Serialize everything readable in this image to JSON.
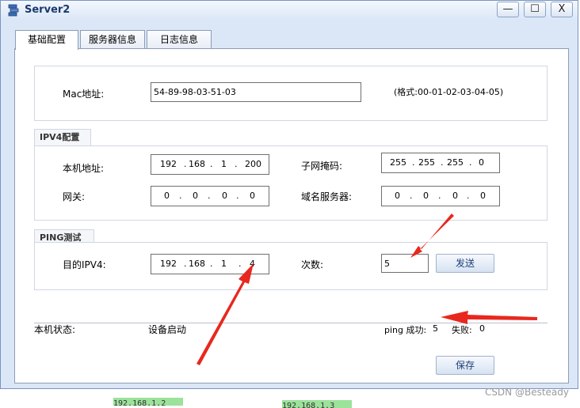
{
  "window": {
    "title": "Server2",
    "controls": {
      "minimize": "—",
      "maximize": "☐",
      "close": "X"
    }
  },
  "tabs": [
    {
      "label": "基础配置",
      "active": true
    },
    {
      "label": "服务器信息",
      "active": false
    },
    {
      "label": "日志信息",
      "active": false
    }
  ],
  "mac": {
    "label": "Mac地址:",
    "value": "54-89-98-03-51-03",
    "format_hint": "(格式:00-01-02-03-04-05)"
  },
  "ipv4": {
    "section_title": "IPV4配置",
    "local_ip_label": "本机地址:",
    "local_ip": [
      "192",
      "168",
      "1",
      "200"
    ],
    "subnet_label": "子网掩码:",
    "subnet": [
      "255",
      "255",
      "255",
      "0"
    ],
    "gateway_label": "网关:",
    "gateway": [
      "0",
      "0",
      "0",
      "0"
    ],
    "dns_label": "域名服务器:",
    "dns": [
      "0",
      "0",
      "0",
      "0"
    ]
  },
  "ping": {
    "section_title": "PING测试",
    "target_label": "目的IPV4:",
    "target": [
      "192",
      "168",
      "1",
      "4"
    ],
    "count_label": "次数:",
    "count": "5",
    "send_label": "发送"
  },
  "status": {
    "label": "本机状态:",
    "value": "设备启动",
    "ping_success_label": "ping 成功:",
    "ping_success": "5",
    "ping_fail_label": "失败:",
    "ping_fail": "0"
  },
  "save_label": "保存",
  "background_tags": [
    "192.168.1.2",
    "192.168.1.3"
  ],
  "watermark": "CSDN @Besteady",
  "colors": {
    "arrow": "#e8281e",
    "window_bg": "#dbe6f7",
    "title_text": "#1a3a6d"
  }
}
